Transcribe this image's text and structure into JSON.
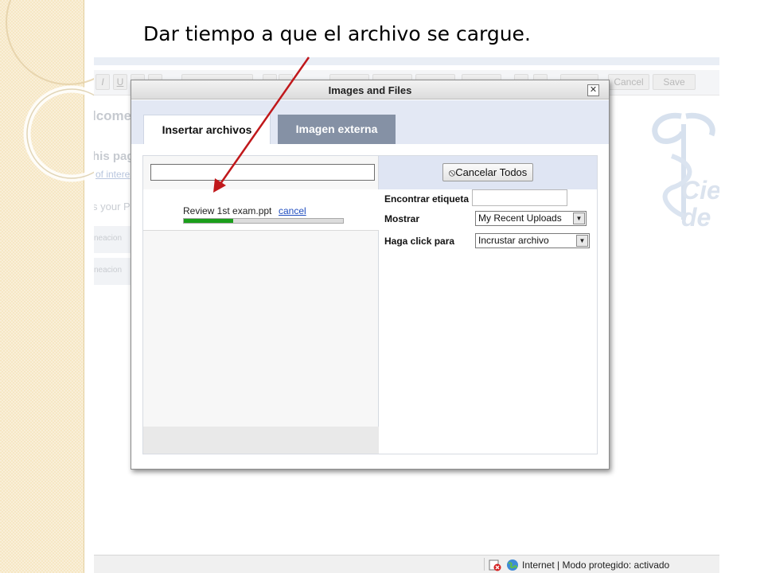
{
  "slide": {
    "title": "Dar tiempo a que el archivo se cargue."
  },
  "background_page": {
    "welcome": "lcome",
    "this_page": "his pag",
    "link_text": "of intere",
    "your_text": "s your P",
    "row1": "neacion",
    "row2": "neacion",
    "toolbar": {
      "italic": "I",
      "underline": "U",
      "cancel_label": "Cancel",
      "save_label": "Save"
    },
    "logo_text": "Cie\nde"
  },
  "dialog": {
    "title": "Images and Files",
    "close_label": "✕",
    "tabs": [
      {
        "label": "Insertar archivos",
        "active": true
      },
      {
        "label": "Imagen externa",
        "active": false
      }
    ],
    "search": {
      "value": ""
    },
    "cancel_all_label": "Cancelar Todos",
    "upload": {
      "file_name": "Review 1st exam.ppt",
      "cancel_label": "cancel",
      "progress": 0.31
    },
    "fields": {
      "tag_label": "Encontrar etiqueta",
      "tag_value": "",
      "show_label": "Mostrar",
      "show_value": "My Recent Uploads",
      "click_label": "Haga click para",
      "click_value": "Incrustar archivo"
    }
  },
  "status_bar": {
    "text": "Internet | Modo protegido: activado"
  },
  "colors": {
    "annotation_arrow": "#c0181b",
    "progress": "#1a9e1a",
    "tab_inactive": "#8591a5",
    "tab_band": "#e3e8f4"
  }
}
